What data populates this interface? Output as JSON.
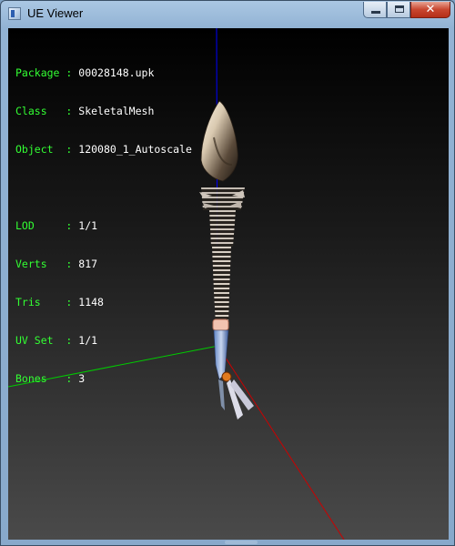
{
  "window": {
    "title": "UE Viewer",
    "controls": {
      "minimize_icon": "minimize-icon",
      "maximize_icon": "maximize-icon",
      "close_icon": "close-icon"
    }
  },
  "info": {
    "separator": ":",
    "rows": [
      {
        "key": "Package",
        "value": "00028148.upk"
      },
      {
        "key": "Class  ",
        "value": "SkeletalMesh"
      },
      {
        "key": "Object ",
        "value": "120080_1_Autoscale"
      },
      {
        "key": "LOD    ",
        "value": "1/1"
      },
      {
        "key": "Verts  ",
        "value": "817"
      },
      {
        "key": "Tris   ",
        "value": "1148"
      },
      {
        "key": "UV Set ",
        "value": "1/1"
      },
      {
        "key": "Bones  ",
        "value": "3"
      }
    ]
  },
  "colors": {
    "info_key": "#33ff33",
    "info_value": "#ffffff",
    "axis_x": "#cc0000",
    "axis_y": "#00cc00",
    "axis_z": "#0000ff"
  },
  "scene": {
    "model": "fish-skeleton-mesh"
  }
}
